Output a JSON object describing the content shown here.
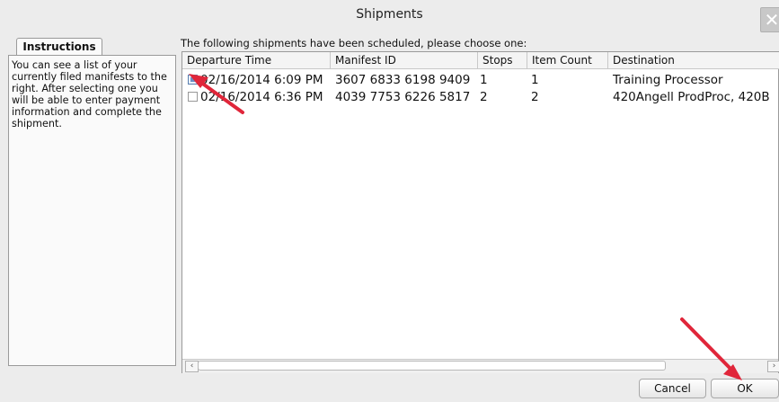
{
  "window": {
    "title": "Shipments",
    "close_icon": "close-icon"
  },
  "instructions": {
    "tab_label": "Instructions",
    "text": "You can see a list of your currently filed manifests to the right. After selecting one you will be able to enter payment information and complete the shipment."
  },
  "main": {
    "lead_text": "The following shipments have been scheduled, please choose one:",
    "columns": [
      "Departure Time",
      "Manifest ID",
      "Stops",
      "Item Count",
      "Destination"
    ],
    "rows": [
      {
        "selected": true,
        "departure": "02/16/2014 6:09 PM",
        "manifest_id": "3607 6833 6198 9409",
        "stops": "1",
        "items": "1",
        "destination": "Training Processor"
      },
      {
        "selected": false,
        "departure": "02/16/2014 6:36 PM",
        "manifest_id": "4039 7753 6226 5817",
        "stops": "2",
        "items": "2",
        "destination": "420Angell ProdProc, 420B"
      }
    ]
  },
  "buttons": {
    "cancel": "Cancel",
    "ok": "OK"
  },
  "colors": {
    "annotation_arrow": "#e0263a"
  }
}
